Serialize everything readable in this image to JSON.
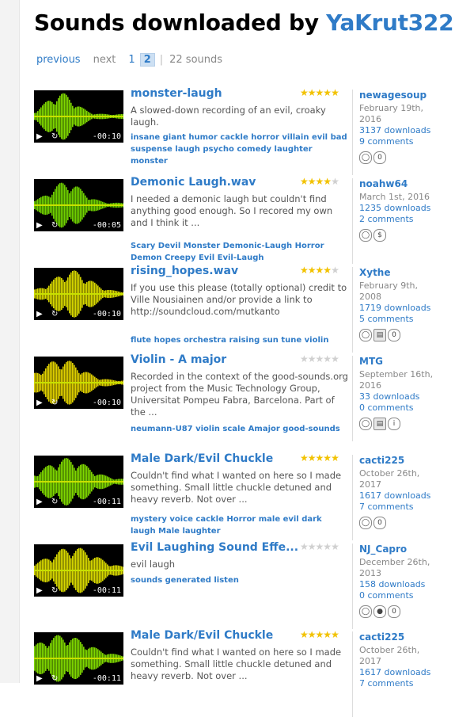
{
  "title": {
    "prefix": "Sounds downloaded by ",
    "user": "YaKrut322"
  },
  "pager": {
    "previous": "previous",
    "next": "next",
    "page1": "1",
    "page2": "2",
    "separator": "|",
    "count": "22 sounds"
  },
  "colors": {
    "link": "#2f7bc7",
    "wave_green": "#7fd800",
    "wave_yellow": "#e0d000",
    "star": "#f2c200"
  },
  "sounds": [
    {
      "name": "monster-laugh",
      "rating": 5,
      "duration": "-00:10",
      "description": "A slowed-down recording of an evil, croaky laugh.",
      "tags": "insane giant humor cackle horror villain evil bad suspense laugh psycho comedy laughter monster",
      "user": "newagesoup",
      "date": "February 19th, 2016",
      "downloads": "3137 downloads",
      "comments": "9 comments",
      "licenses": [
        "attribution-icon",
        "zero-icon"
      ]
    },
    {
      "name": "Demonic Laugh.wav",
      "rating": 4,
      "duration": "-00:05",
      "description": "I needed a demonic laugh but couldn't find anything good enough. So I recored my own and I think it ...",
      "tags": "Scary Devil Monster Demonic-Laugh Horror Demon Creepy Evil Evil-Laugh",
      "user": "noahw64",
      "date": "March 1st, 2016",
      "downloads": "1235 downloads",
      "comments": "2 comments",
      "licenses": [
        "attribution-icon",
        "noncommercial-icon"
      ]
    },
    {
      "name": "rising_hopes.wav",
      "rating": 4,
      "duration": "-00:10",
      "description": "If you use this please (totally optional) credit to Ville Nousiainen and/or provide a link to http://soundcloud.com/mutkanto",
      "tags": "flute hopes orchestra raising sun tune violin",
      "user": "Xythe",
      "date": "February 9th, 2008",
      "downloads": "1719 downloads",
      "comments": "5 comments",
      "licenses": [
        "attribution-icon",
        "file-icon",
        "zero-icon"
      ]
    },
    {
      "name": "Violin - A major",
      "rating": 0,
      "duration": "-00:10",
      "description": "Recorded in the context of the good-sounds.org project from the Music Technology Group, Universitat Pompeu Fabra, Barcelona. Part of the ...",
      "tags": "neumann-U87 violin scale Amajor good-sounds",
      "user": "MTG",
      "date": "September 16th, 2016",
      "downloads": "33 downloads",
      "comments": "0 comments",
      "licenses": [
        "attribution-icon",
        "file-icon",
        "info-icon"
      ]
    },
    {
      "name": "Male Dark/Evil Chuckle",
      "rating": 5,
      "duration": "-00:11",
      "description": "Couldn't find what I wanted on here so I made something. Small little chuckle detuned and heavy reverb. Not over ...",
      "tags": "mystery voice cackle Horror male evil dark laugh Male laughter",
      "user": "cacti225",
      "date": "October 26th, 2017",
      "downloads": "1617 downloads",
      "comments": "7 comments",
      "licenses": [
        "attribution-icon",
        "zero-icon"
      ]
    },
    {
      "name": "Evil Laughing Sound Effe...",
      "rating": 0,
      "duration": "-00:11",
      "description": "evil laugh",
      "tags": "sounds generated listen",
      "user": "NJ_Capro",
      "date": "December 26th, 2013",
      "downloads": "158 downloads",
      "comments": "0 comments",
      "licenses": [
        "attribution-icon",
        "pin-icon",
        "zero-icon"
      ]
    },
    {
      "name": "Male Dark/Evil Chuckle",
      "rating": 5,
      "duration": "-00:11",
      "description": "Couldn't find what I wanted on here so I made something. Small little chuckle detuned and heavy reverb. Not over ...",
      "tags": "",
      "user": "cacti225",
      "date": "October 26th, 2017",
      "downloads": "1617 downloads",
      "comments": "7 comments",
      "licenses": []
    }
  ]
}
